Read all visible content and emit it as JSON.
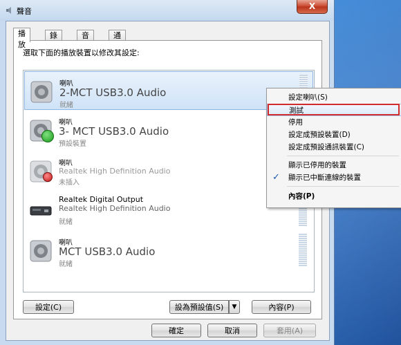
{
  "window": {
    "title": "聲音",
    "close_symbol": "X"
  },
  "tabs": [
    "播放",
    "錄製",
    "音效",
    "通訊"
  ],
  "instruction": "選取下面的播放裝置以修改其設定:",
  "devices": [
    {
      "line1": "喇叭",
      "line2": "2-MCT USB3.0 Audio",
      "status": "就緒",
      "badge": "none",
      "selected": true
    },
    {
      "line1": "喇叭",
      "line2": "3- MCT USB3.0 Audio",
      "status": "預設裝置",
      "badge": "default-check",
      "selected": false
    },
    {
      "line1": "喇叭",
      "line2": "Realtek High Definition Audio",
      "status": "未插入",
      "badge": "unplugged",
      "selected": false
    },
    {
      "line1": "Realtek Digital Output",
      "line2": "Realtek High Definition Audio",
      "status": "就緒",
      "badge": "none",
      "selected": false
    },
    {
      "line1": "喇叭",
      "line2": "MCT USB3.0 Audio",
      "status": "就緒",
      "badge": "none",
      "selected": false
    }
  ],
  "buttons": {
    "configure": "設定(C)",
    "set_default": "設為預設值(S)",
    "properties": "內容(P)",
    "ok": "確定",
    "cancel": "取消",
    "apply": "套用(A)"
  },
  "context_menu": {
    "items": [
      {
        "label": "設定喇叭(S)",
        "checked": false,
        "highlighted": false
      },
      {
        "label": "測試",
        "checked": false,
        "highlighted": true
      },
      {
        "label": "停用",
        "checked": false,
        "highlighted": false
      },
      {
        "label": "設定成預設裝置(D)",
        "checked": false,
        "highlighted": false
      },
      {
        "label": "設定成預設通訊裝置(C)",
        "checked": false,
        "highlighted": false
      },
      {
        "label": "顯示已停用的裝置",
        "checked": false,
        "highlighted": false
      },
      {
        "label": "顯示已中斷連線的裝置",
        "checked": true,
        "highlighted": false
      },
      {
        "label": "內容(P)",
        "checked": false,
        "highlighted": false,
        "bold": true
      }
    ]
  },
  "colors": {
    "highlight_box": "#d12b2b",
    "accent": "#1a56b0"
  }
}
